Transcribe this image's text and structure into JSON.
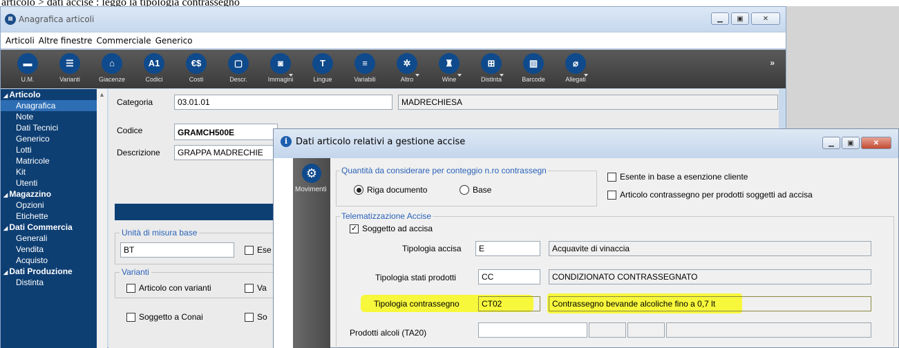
{
  "caption": "articolo > dati accise : leggo la tipologia contrassegno",
  "main_window": {
    "title": "Anagrafica articoli",
    "menu": [
      "Articoli",
      "Altre finestre",
      "Commerciale",
      "Generico"
    ],
    "toolbar": [
      {
        "label": "U.M.",
        "icon": "ruler-icon",
        "glyph": "▬",
        "dropdown": false
      },
      {
        "label": "Varianti",
        "icon": "variants-icon",
        "glyph": "☰",
        "dropdown": false
      },
      {
        "label": "Giacenze",
        "icon": "stock-icon",
        "glyph": "⌂",
        "dropdown": false
      },
      {
        "label": "Codici",
        "icon": "codes-icon",
        "glyph": "A1",
        "dropdown": false
      },
      {
        "label": "Costi",
        "icon": "costs-icon",
        "glyph": "€$",
        "dropdown": false
      },
      {
        "label": "Descr.",
        "icon": "description-icon",
        "glyph": "▢",
        "dropdown": false
      },
      {
        "label": "Immagini",
        "icon": "images-icon",
        "glyph": "◙",
        "dropdown": true
      },
      {
        "label": "Lingue",
        "icon": "languages-icon",
        "glyph": "T",
        "dropdown": false
      },
      {
        "label": "Variabili",
        "icon": "variables-icon",
        "glyph": "≡",
        "dropdown": false
      },
      {
        "label": "Altro",
        "icon": "other-icon",
        "glyph": "✲",
        "dropdown": true
      },
      {
        "label": "Wine",
        "icon": "wine-icon",
        "glyph": "♜",
        "dropdown": true
      },
      {
        "label": "Distinta",
        "icon": "bill-of-materials-icon",
        "glyph": "⊞",
        "dropdown": true
      },
      {
        "label": "Barcode",
        "icon": "barcode-icon",
        "glyph": "▥",
        "dropdown": false
      },
      {
        "label": "Allegati",
        "icon": "attachment-icon",
        "glyph": "⌀",
        "dropdown": true
      }
    ],
    "toolbar_more": "»"
  },
  "sidebar": [
    {
      "label": "Articolo",
      "group": true
    },
    {
      "label": "Anagrafica",
      "group": false,
      "selected": true
    },
    {
      "label": "Note",
      "group": false
    },
    {
      "label": "Dati Tecnici",
      "group": false
    },
    {
      "label": "Generico",
      "group": false
    },
    {
      "label": "Lotti",
      "group": false
    },
    {
      "label": "Matricole",
      "group": false
    },
    {
      "label": "Kit",
      "group": false
    },
    {
      "label": "Utenti",
      "group": false
    },
    {
      "label": "Magazzino",
      "group": true
    },
    {
      "label": "Opzioni",
      "group": false
    },
    {
      "label": "Etichette",
      "group": false
    },
    {
      "label": "Dati Commercia",
      "group": true
    },
    {
      "label": "Generali",
      "group": false
    },
    {
      "label": "Vendita",
      "group": false
    },
    {
      "label": "Acquisto",
      "group": false
    },
    {
      "label": "Dati Produzione",
      "group": true
    },
    {
      "label": "Distinta",
      "group": false
    }
  ],
  "article": {
    "categoria_label": "Categoria",
    "categoria_value": "03.01.01",
    "categoria_desc": "MADRECHIESA",
    "codice_label": "Codice",
    "codice_value": "GRAMCH500E",
    "descrizione_label": "Descrizione",
    "descrizione_value": "GRAPPA MADRECHIE",
    "unita_group": "Unità di misura base",
    "unita_value": "BT",
    "unita_check_label": "Ese",
    "varianti_group": "Varianti",
    "articolo_varianti": "Articolo con varianti",
    "va_label": "Va",
    "conai_label": "Soggetto a Conai",
    "sog_label": "So"
  },
  "dialog": {
    "title": "Dati articolo relativi a gestione accise",
    "side_label": "Movimenti",
    "quantita_group": "Quantità da considerare per conteggio n.ro contrassegn",
    "radio_riga": "Riga documento",
    "radio_base": "Base",
    "esente_label": "Esente in base a esenzione cliente",
    "articolo_contrassegno_label": "Articolo contrassegno per prodotti soggetti ad accisa",
    "telem_group": "Telematizzazione Accise",
    "soggetto_accisa_label": "Soggetto ad accisa",
    "soggetto_accisa_checked": true,
    "tipologia_accisa_label": "Tipologia accisa",
    "tipologia_accisa_code": "E",
    "tipologia_accisa_desc": "Acquavite di vinaccia",
    "stati_label": "Tipologia stati prodotti",
    "stati_code": "CC",
    "stati_desc": "CONDIZIONATO CONTRASSEGNATO",
    "contrassegno_label": "Tipologia contrassegno",
    "contrassegno_code": "CT02",
    "contrassegno_desc": "Contrassegno bevande alcoliche fino a 0,7 lt",
    "alcoli_label": "Prodotti alcoli (TA20)"
  },
  "colors": {
    "highlight": "#f7f73c",
    "sidebar_bg": "#0e3f73",
    "accent_blue": "#2a62b8"
  }
}
